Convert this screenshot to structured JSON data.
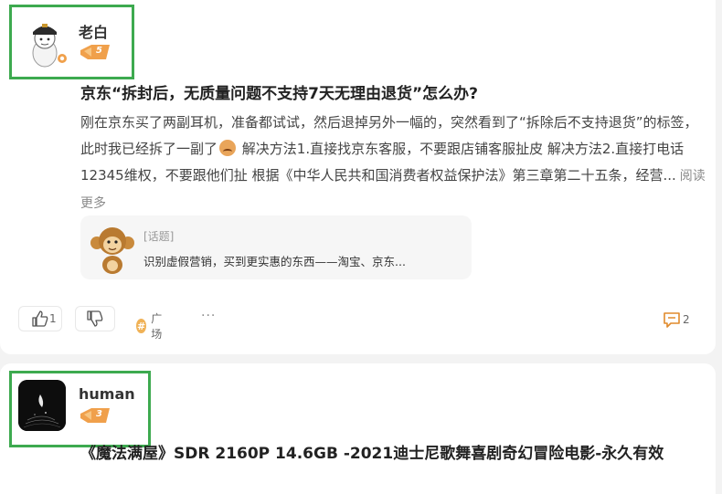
{
  "post1": {
    "author": {
      "name": "老白",
      "level": "5",
      "avatar_icon": "cartoon-person-avatar-icon"
    },
    "title": "京东“拆封后，无质量问题不支持7天无理由退货”怎么办?",
    "excerpt_part1": "刚在京东买了两副耳机，准备都试试，然后退掉另外一幅的，突然看到了“拆除后不支持退货”的标签，此时我已经拆了一副了",
    "excerpt_part2": " 解决方法1.直接找京东客服，不要跟店铺客服扯皮 解决方法2.直接打电话12345维权，不要跟他们扯 根据《中华人民共和国消费者权益保护法》第三章第二十五条，经营...",
    "read_more": "阅读更多",
    "topic": {
      "label": "[话题]",
      "description": "识别虚假营销，买到更实惠的东西——淘宝、京东...",
      "icon": "monkey-mascot-icon"
    },
    "actions": {
      "like_count": "1",
      "square_label": "广场",
      "more": "···",
      "comment_count": "2"
    }
  },
  "post2": {
    "author": {
      "name": "human",
      "level": "3",
      "avatar_icon": "dark-abstract-avatar-icon"
    },
    "title": "《魔法满屋》SDR 2160P 14.6GB -2021迪士尼歌舞喜剧奇幻冒险电影-永久有效"
  },
  "colors": {
    "highlight_border": "#3daa4f",
    "badge_orange": "#f0a04b",
    "hash_orange": "#f0b257",
    "comment_orange": "#e08a2c"
  }
}
